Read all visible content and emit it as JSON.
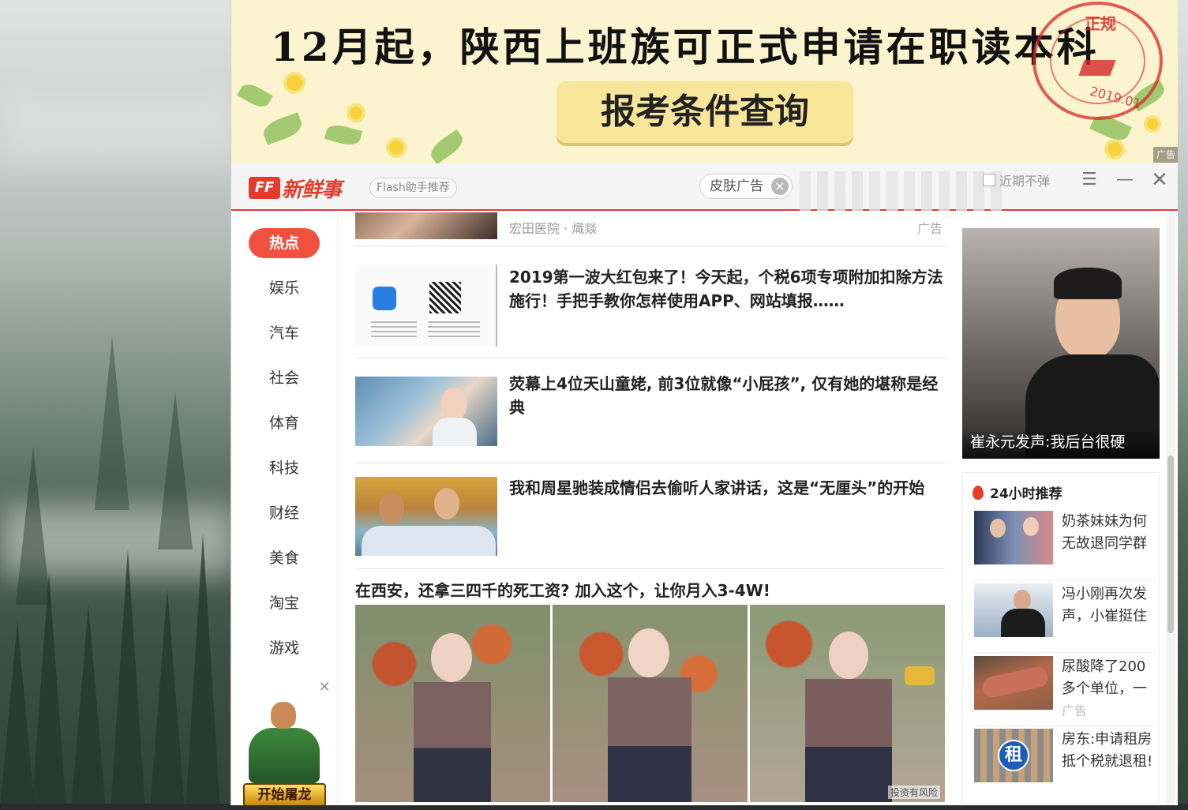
{
  "banner": {
    "title": "12月起，陕西上班族可正式申请在职读本科",
    "button": "报考条件查询",
    "stamp_text": "正规",
    "stamp_year": "2019.01",
    "corner_label": "广告"
  },
  "header": {
    "logo_mark": "FF",
    "logo_text": "新鲜事",
    "flash_tag": "Flash助手推荐",
    "skin_ad": "皮肤广告",
    "no_popup": "近期不弹",
    "menu_icon": "menu-icon",
    "minimize_icon": "minimize-icon",
    "close_icon": "close-icon"
  },
  "sidebar": {
    "items": [
      {
        "label": "热点",
        "active": true
      },
      {
        "label": "娱乐"
      },
      {
        "label": "汽车"
      },
      {
        "label": "社会"
      },
      {
        "label": "体育"
      },
      {
        "label": "科技"
      },
      {
        "label": "财经"
      },
      {
        "label": "美食"
      },
      {
        "label": "淘宝"
      },
      {
        "label": "游戏"
      }
    ],
    "ad_button": "开始屠龙"
  },
  "feed": {
    "items": [
      {
        "source": "宏田医院 · 熾燚",
        "ad": "广告"
      },
      {
        "title": "2019第一波大红包来了！今天起，个税6项专项附加扣除方法施行！手把手教你怎样使用APP、网站填报……"
      },
      {
        "title": "荧幕上4位天山童姥, 前3位就像“小屁孩”, 仅有她的堪称是经典"
      },
      {
        "title": "我和周星驰装成情侣去偷听人家讲话，这是“无厘头”的开始"
      }
    ],
    "big_ad_title": "在西安，还拿三四千的死工资? 加入这个，让你月入3-4W!",
    "risk_label": "投资有风险"
  },
  "right": {
    "hero_caption": "崔永元发声:我后台很硬",
    "rec_title": "24小时推荐",
    "rec_items": [
      {
        "text": "奶茶妹妹为何无故退同学群"
      },
      {
        "text": "冯小刚再次发声，小崔挺住"
      },
      {
        "text": "尿酸降了200多个单位，一",
        "ad": "广告"
      },
      {
        "text": "房东:申请租房抵个税就退租!"
      }
    ],
    "rent_badge": "租"
  },
  "colors": {
    "accent": "#e33b2e",
    "banner_bg": "#fbf4cf"
  }
}
